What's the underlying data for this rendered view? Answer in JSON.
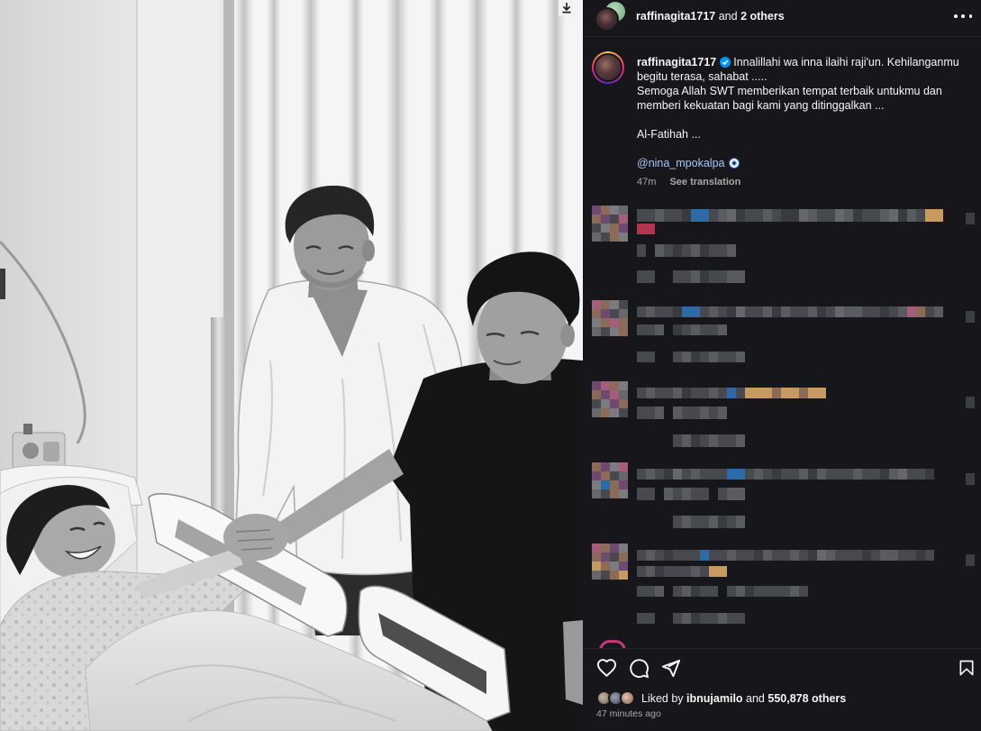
{
  "theme": {
    "panel_bg": "#17171b",
    "text": "#f5f5f5",
    "secondary_text": "#a8a8a8",
    "mention": "#a8c7fa",
    "verified_badge": "#0095f6",
    "divider": "#262626"
  },
  "photo": {
    "download_icon": "download-arrow-icon"
  },
  "header": {
    "username": "raffinagita1717",
    "joiner": "and",
    "others": "2 others",
    "more_icon": "more-horizontal-icon"
  },
  "caption": {
    "username": "raffinagita1717",
    "verified_icon": "verified-badge-icon",
    "first_line_text": "Innalillahi wa inna ilaihi raji'un. Kehilanganmu",
    "lines": [
      "begitu terasa, sahabat .....",
      "Semoga Allah SWT memberikan tempat terbaik untukmu dan",
      "memberi kekuatan bagi kami yang ditinggalkan ..."
    ],
    "closing": "Al-Fatihah ...",
    "mention": "@nina_mpokalpa",
    "mention_emoji_icon": "nazar-amulet-emoji-icon",
    "time": "47m",
    "see_translation": "See translation"
  },
  "actions": {
    "like_icon": "heart-icon",
    "comment_icon": "comment-bubble-icon",
    "share_icon": "paper-plane-share-icon",
    "save_icon": "bookmark-icon"
  },
  "likes": {
    "prefix": "Liked by",
    "user": "ibnujamilo",
    "joiner": "and",
    "count_text": "550,878 others",
    "timestamp": "47 minutes ago"
  }
}
